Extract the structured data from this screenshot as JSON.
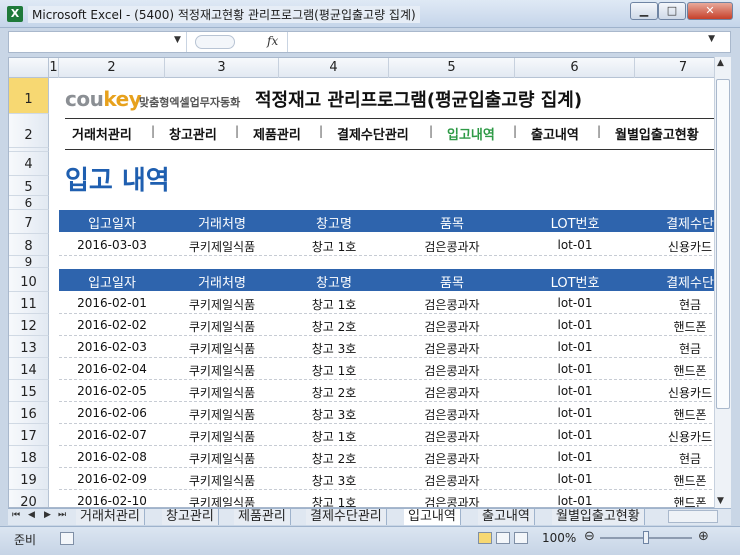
{
  "window": {
    "title": "Microsoft Excel - (5400) 적정재고현황 관리프로그램(평균입출고량 집계)",
    "app_icon": "X"
  },
  "formula_bar": {
    "fx": "fx"
  },
  "columns": [
    "1",
    "2",
    "3",
    "4",
    "5",
    "6",
    "7"
  ],
  "rows": [
    "1",
    "2",
    "3",
    "4",
    "5",
    "6",
    "7",
    "8",
    "9",
    "10",
    "11",
    "12",
    "13",
    "14",
    "15",
    "16",
    "17",
    "18",
    "19",
    "20"
  ],
  "brand": {
    "logo_main": "cou",
    "logo_key": "key",
    "subtitle": "맞춤형엑셀업무자동화"
  },
  "app_title": "적정재고 관리프로그램(평균입출고량 집계)",
  "nav": {
    "items": [
      "거래처관리",
      "창고관리",
      "제품관리",
      "결제수단관리",
      "입고내역",
      "출고내역",
      "월별입출고현황"
    ],
    "separator": "|",
    "active": "입고내역"
  },
  "section_title": "입고 내역",
  "table_headers": [
    "입고일자",
    "거래처명",
    "창고명",
    "품목",
    "LOT번호",
    "결제수단"
  ],
  "input_row": [
    "2016-03-03",
    "쿠키제일식품",
    "창고 1호",
    "검은콩과자",
    "lot-01",
    "신용카드"
  ],
  "records": [
    [
      "2016-02-01",
      "쿠키제일식품",
      "창고 1호",
      "검은콩과자",
      "lot-01",
      "현금"
    ],
    [
      "2016-02-02",
      "쿠키제일식품",
      "창고 2호",
      "검은콩과자",
      "lot-01",
      "핸드폰"
    ],
    [
      "2016-02-03",
      "쿠키제일식품",
      "창고 3호",
      "검은콩과자",
      "lot-01",
      "현금"
    ],
    [
      "2016-02-04",
      "쿠키제일식품",
      "창고 1호",
      "검은콩과자",
      "lot-01",
      "핸드폰"
    ],
    [
      "2016-02-05",
      "쿠키제일식품",
      "창고 2호",
      "검은콩과자",
      "lot-01",
      "신용카드"
    ],
    [
      "2016-02-06",
      "쿠키제일식품",
      "창고 3호",
      "검은콩과자",
      "lot-01",
      "핸드폰"
    ],
    [
      "2016-02-07",
      "쿠키제일식품",
      "창고 1호",
      "검은콩과자",
      "lot-01",
      "신용카드"
    ],
    [
      "2016-02-08",
      "쿠키제일식품",
      "창고 2호",
      "검은콩과자",
      "lot-01",
      "현금"
    ],
    [
      "2016-02-09",
      "쿠키제일식품",
      "창고 3호",
      "검은콩과자",
      "lot-01",
      "핸드폰"
    ],
    [
      "2016-02-10",
      "쿠키제일식품",
      "창고 1호",
      "검은콩과자",
      "lot-01",
      "핸드폰"
    ]
  ],
  "sheet_tabs": [
    "거래처관리",
    "창고관리",
    "제품관리",
    "결제수단관리",
    "입고내역",
    "출고내역",
    "월별입출고현황"
  ],
  "active_tab": "입고내역",
  "status": {
    "ready": "준비",
    "zoom": "100%"
  },
  "colors": {
    "header_blue": "#2e64ad",
    "title_blue": "#1f5fb0",
    "active_green": "#2e9a46",
    "logo_orange": "#e7a11c"
  }
}
